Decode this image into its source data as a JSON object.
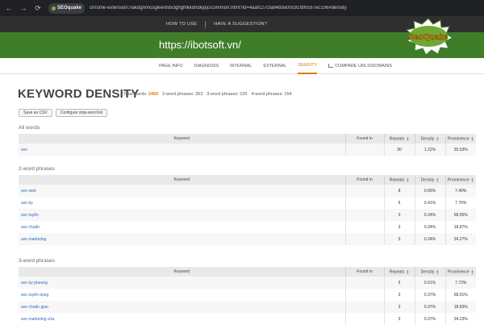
{
  "browser": {
    "chip_label": "SEOquake",
    "url": "chrome-extension://akdgnmcogleenhbclghghlkkdndkjdjc/common.html?id=4aafc27cfa84b9a00c91fdf0c67ec106#density"
  },
  "topnav": {
    "how_to_use": "HOW TO USE",
    "suggestion": "HAVE A SUGGESTION?"
  },
  "site_title": "https://ibotsoft.vn/",
  "logo_text": "SeoQuake",
  "tabs": [
    "PAGE INFO",
    "DIAGNOSIS",
    "INTERNAL",
    "EXTERNAL",
    "DENSITY",
    "COMPARE URLS/DOMAINS"
  ],
  "heading": "KEYWORD DENSITY",
  "stats": {
    "total_label": "Total words:",
    "total_value": "2450",
    "two_label": "2-word phrases:",
    "two_value": "303",
    "three_label": "3-word phrases:",
    "three_value": "225",
    "four_label": "4-word phrases:",
    "four_value": "154"
  },
  "buttons": {
    "save_csv": "Save as CSV",
    "configure": "Configure stop-word list"
  },
  "columns": {
    "keyword": "Keyword",
    "found_in": "Found in",
    "repeats": "Repeats",
    "density": "Density",
    "prominence": "Prominence"
  },
  "sections": [
    {
      "title": "All words",
      "rows": [
        {
          "keyword": "seo",
          "found_in": "",
          "repeats": "30",
          "density": "1.22%",
          "prominence": "30.53%"
        }
      ]
    },
    {
      "title": "2-word phrases",
      "rows": [
        {
          "keyword": "seo web",
          "found_in": "",
          "repeats": "8",
          "density": "0.65%",
          "prominence": "7.49%"
        },
        {
          "keyword": "seo by",
          "found_in": "",
          "repeats": "5",
          "density": "0.41%",
          "prominence": "7.76%"
        },
        {
          "keyword": "seo tuyển",
          "found_in": "",
          "repeats": "3",
          "density": "0.24%",
          "prominence": "58.05%"
        },
        {
          "keyword": "seo chuẩn",
          "found_in": "",
          "repeats": "3",
          "density": "0.24%",
          "prominence": "18.87%"
        },
        {
          "keyword": "seo marketing",
          "found_in": "",
          "repeats": "3",
          "density": "0.24%",
          "prominence": "34.27%"
        }
      ]
    },
    {
      "title": "3-word phrases",
      "rows": [
        {
          "keyword": "seo by phuong",
          "found_in": "",
          "repeats": "5",
          "density": "0.61%",
          "prominence": "7.72%"
        },
        {
          "keyword": "seo tuyển dụng",
          "found_in": "",
          "repeats": "3",
          "density": "0.37%",
          "prominence": "58.01%"
        },
        {
          "keyword": "seo chuẩn giao",
          "found_in": "",
          "repeats": "3",
          "density": "0.37%",
          "prominence": "18.83%"
        },
        {
          "keyword": "seo marketing cửa",
          "found_in": "",
          "repeats": "3",
          "density": "0.37%",
          "prominence": "34.23%"
        }
      ]
    }
  ]
}
